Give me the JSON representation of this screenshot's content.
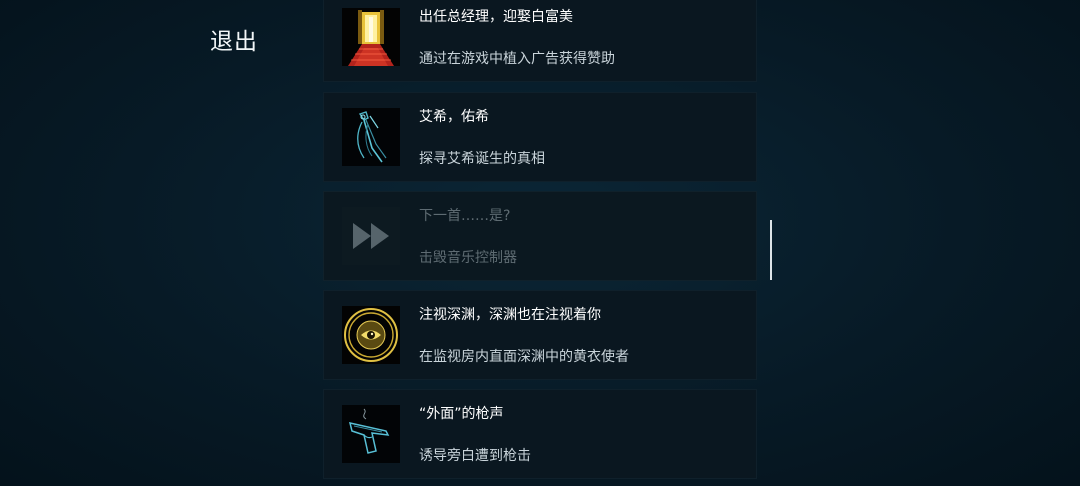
{
  "exit_label": "退出",
  "achievements": [
    {
      "icon": "golden-door-icon",
      "title": "出任总经理，迎娶白富美",
      "description": "通过在游戏中植入广告获得赞助",
      "locked": false
    },
    {
      "icon": "blade-icon",
      "title": "艾希，佑希",
      "description": "探寻艾希诞生的真相",
      "locked": false
    },
    {
      "icon": "fast-forward-icon",
      "title": "下一首……是?",
      "description": "击毁音乐控制器",
      "locked": true
    },
    {
      "icon": "eye-emblem-icon",
      "title": "注视深渊，深渊也在注视着你",
      "description": "在监视房内直面深渊中的黄衣使者",
      "locked": false
    },
    {
      "icon": "pistol-icon",
      "title": "“外面”的枪声",
      "description": "诱导旁白遭到枪击",
      "locked": false
    }
  ]
}
